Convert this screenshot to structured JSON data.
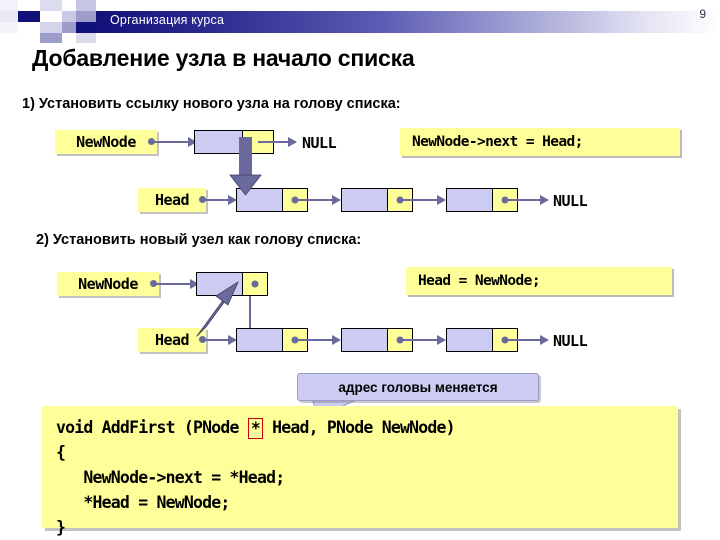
{
  "header": {
    "title": "Организация курса",
    "page_number": "9",
    "bar_gradient_start": "#11117a",
    "bar_gradient_end": "#ffffff"
  },
  "slide": {
    "title": "Добавление узла в начало списка",
    "step1": "1) Установить ссылку нового узла на голову списка:",
    "step2": "2) Установить новый узел как голову списка:"
  },
  "diagram1": {
    "newnode_label": "NewNode",
    "head_label": "Head",
    "null_top": "NULL",
    "null_bottom": "NULL",
    "code": "NewNode->next = Head;"
  },
  "diagram2": {
    "newnode_label": "NewNode",
    "head_label": "Head",
    "null_bottom": "NULL",
    "code": "Head = NewNode;"
  },
  "callout": {
    "text": "адрес головы меняется"
  },
  "main_code": {
    "line1_a": "void AddFirst (PNode ",
    "line1_star": "*",
    "line1_b": " Head, PNode NewNode)",
    "line2": "{",
    "line3": "   NewNode->next = *Head;",
    "line4": "   *Head = NewNode;",
    "line5": "}"
  },
  "colors": {
    "node_data": "#ccccf2",
    "node_pointer": "#ffff99",
    "arrow": "#6a6a9c",
    "label_bg": "#ffff99",
    "code_bg": "#ffff99",
    "highlight_border": "#cc0000",
    "header_text": "#ffffff"
  }
}
